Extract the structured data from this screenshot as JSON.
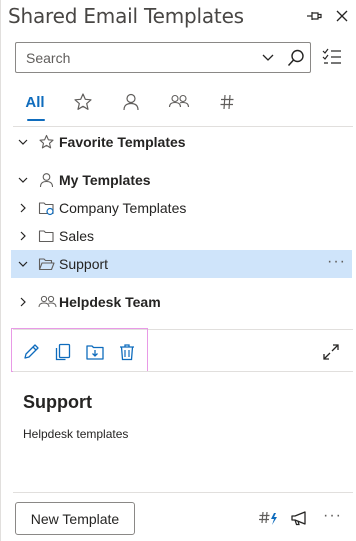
{
  "header": {
    "title": "Shared Email Templates"
  },
  "search": {
    "placeholder": "Search"
  },
  "tabs": [
    {
      "label": "All",
      "icon": "list-all",
      "active": true
    },
    {
      "label": "",
      "icon": "star-icon"
    },
    {
      "label": "",
      "icon": "person-icon"
    },
    {
      "label": "",
      "icon": "people-icon"
    },
    {
      "label": "",
      "icon": "hashtag-icon"
    }
  ],
  "tree": {
    "favorites": {
      "label": "Favorite Templates"
    },
    "my_templates": {
      "label": "My Templates"
    },
    "company": {
      "label": "Company Templates"
    },
    "sales": {
      "label": "Sales"
    },
    "support": {
      "label": "Support",
      "more": "···"
    },
    "helpdesk": {
      "label": "Helpdesk Team"
    }
  },
  "details": {
    "title": "Support",
    "description": "Helpdesk templates"
  },
  "footer": {
    "new_template_label": "New Template",
    "more": "···"
  },
  "colors": {
    "accent": "#0f6cbd",
    "selection": "#cfe4fa",
    "highlight_frame": "#e89ae6"
  }
}
